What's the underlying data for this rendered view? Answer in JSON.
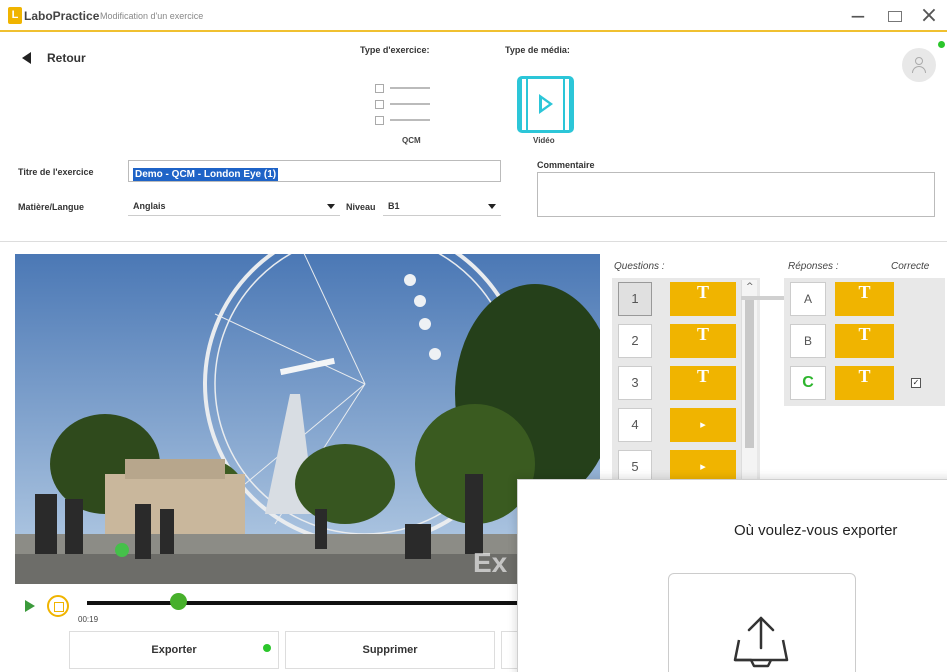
{
  "window": {
    "logo_mark": "L",
    "app_name": "LaboPractice",
    "title": "Modification d'un exercice",
    "minimize": "−",
    "close": "×"
  },
  "header": {
    "back_label": "Retour",
    "exercise_type_label": "Type d'exercice:",
    "media_type_label": "Type de média:",
    "exercise_type": "QCM",
    "media_type": "Vidéo"
  },
  "form": {
    "title_label": "Titre de l'exercice",
    "title_value": "Demo - QCM - London Eye (1)",
    "subject_label": "Matière/Langue",
    "subject_value": "Anglais",
    "level_label": "Niveau",
    "level_value": "B1",
    "comment_label": "Commentaire",
    "comment_value": ""
  },
  "player": {
    "time": "00:19",
    "progress": 0.16,
    "watermark": "Ex"
  },
  "buttons": {
    "export": "Exporter",
    "delete": "Supprimer"
  },
  "questions": {
    "title": "Questions :",
    "items": [
      {
        "num": "1",
        "type": "T"
      },
      {
        "num": "2",
        "type": "T"
      },
      {
        "num": "3",
        "type": "T"
      },
      {
        "num": "4",
        "type": "▸"
      },
      {
        "num": "5",
        "type": "▸"
      }
    ],
    "scroll_up": "^"
  },
  "answers": {
    "title": "Réponses :",
    "correct_title": "Correcte",
    "items": [
      {
        "letter": "A",
        "type": "T",
        "correct": false
      },
      {
        "letter": "B",
        "type": "T",
        "correct": false
      },
      {
        "letter": "C",
        "type": "T",
        "correct": true
      }
    ],
    "check_mark": "✓"
  },
  "dialog": {
    "title": "Où voulez-vous exporter"
  },
  "colors": {
    "accent_yellow": "#f0b400",
    "video_cyan": "#2cc6d8",
    "success_green": "#2bc62b",
    "selection_blue": "#1e63c7"
  }
}
